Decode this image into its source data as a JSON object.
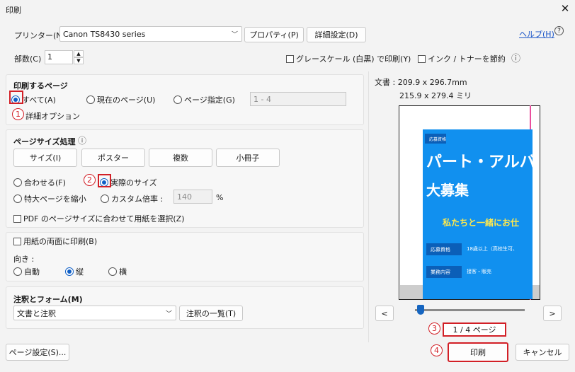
{
  "window": {
    "title": "印刷",
    "close": "✕"
  },
  "printer": {
    "label": "プリンター(N) :",
    "value": "Canon TS8430 series",
    "properties": "プロパティ(P)",
    "advanced": "詳細設定(D)"
  },
  "help": {
    "label": "ヘルプ(H)",
    "icon": "?"
  },
  "copies": {
    "label": "部数(C) :",
    "value": "1"
  },
  "options": {
    "grayscale": "グレースケール (白黒) で印刷(Y)",
    "save_ink": "インク / トナーを節約",
    "info_icon": "ⓘ"
  },
  "pages": {
    "heading": "印刷するページ",
    "all": "すべて(A)",
    "current": "現在のページ(U)",
    "specify": "ページ指定(G)",
    "range_placeholder": "1 - 4",
    "more": "詳細オプション"
  },
  "size": {
    "heading": "ページサイズ処理",
    "info_icon": "ⓘ",
    "tabs": [
      "サイズ(I)",
      "ポスター",
      "複数",
      "小冊子"
    ],
    "fit": "合わせる(F)",
    "actual": "実際のサイズ",
    "shrink": "特大ページを縮小",
    "custom": "カスタム倍率 :",
    "custom_value": "140",
    "percent": "%",
    "pdf_paper": "PDF のページサイズに合わせて用紙を選択(Z)"
  },
  "duplex": {
    "label": "用紙の両面に印刷(B)"
  },
  "orientation": {
    "label": "向き :",
    "auto": "自動",
    "portrait": "縦",
    "landscape": "横"
  },
  "comments": {
    "heading": "注釈とフォーム(M)",
    "value": "文書と注釈",
    "summary": "注釈の一覧(T)"
  },
  "preview": {
    "doc_size": "文書 : 209.9 x 296.7mm",
    "paper_size": "215.9 x 279.4 ミリ",
    "prev": "<",
    "next": ">",
    "page_indicator": "1 / 4 ページ",
    "slider_fraction": 0.02,
    "poster": {
      "tag1": "応募資格",
      "headline1": "パート・アルバ",
      "headline2": "大募集",
      "sub": "私たちと一緒にお仕",
      "row1_tag": "応募資格",
      "row1_text": "18歳以上（高校生可、",
      "row2_tag": "業務内容",
      "row2_text": "接客・販売"
    }
  },
  "footer": {
    "page_setup": "ページ設定(S)...",
    "print": "印刷",
    "cancel": "キャンセル"
  },
  "annotations": {
    "n1": "1",
    "n2": "2",
    "n3": "3",
    "n4": "4"
  },
  "colors": {
    "accent": "#0f5fc6",
    "marker": "#d21f26",
    "poster": "#1190ef"
  }
}
